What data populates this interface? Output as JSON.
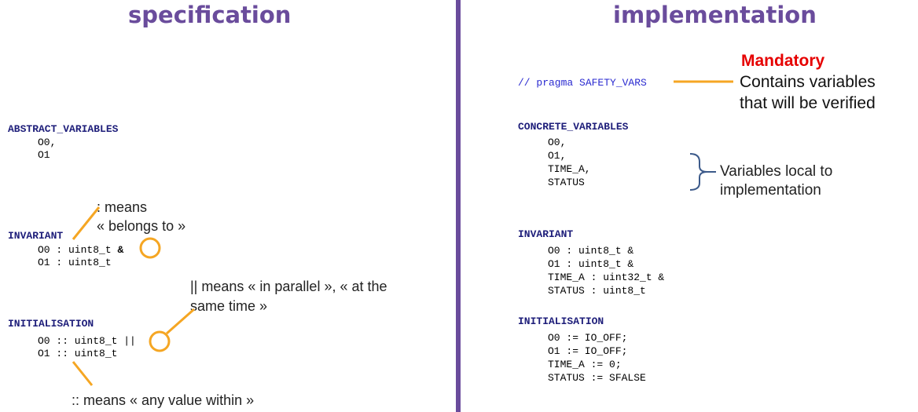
{
  "spec": {
    "title": "specification",
    "abstract_kw": "ABSTRACT_VARIABLES",
    "abstract_lines": [
      "O0,",
      "O1"
    ],
    "invariant_kw": "INVARIANT",
    "invariant_line1": "O0 : uint8_t",
    "invariant_op": "&",
    "invariant_line2": "O1 : uint8_t",
    "init_kw": "INITIALISATION",
    "init_line1": "O0 :: uint8_t",
    "init_op": "||",
    "init_line2": "O1 :: uint8_t",
    "note_belongs_1": ": means",
    "note_belongs_2": "« belongs to »",
    "note_parallel_1": "|| means « in parallel », « at the",
    "note_parallel_2": "same time »",
    "note_within": ":: means « any value within »"
  },
  "impl": {
    "title": "implementation",
    "pragma": "// pragma SAFETY_VARS",
    "mandatory": "Mandatory",
    "mandatory_desc_1": "Contains variables",
    "mandatory_desc_2": "that will be verified",
    "concrete_kw": "CONCRETE_VARIABLES",
    "concrete_lines": [
      "O0,",
      "O1,",
      "TIME_A,",
      "STATUS"
    ],
    "local_note_1": "Variables local to",
    "local_note_2": "implementation",
    "invariant_kw": "INVARIANT",
    "invariant_lines": [
      "O0 : uint8_t &",
      "O1 : uint8_t &",
      "TIME_A : uint32_t &",
      "STATUS : uint8_t"
    ],
    "init_kw": "INITIALISATION",
    "init_lines": [
      "O0 := IO_OFF;",
      "O1 := IO_OFF;",
      "TIME_A := 0;",
      "STATUS := SFALSE"
    ]
  },
  "colors": {
    "title": "#6a4c9c",
    "divider": "#6a4c9c",
    "callout": "#f5a623",
    "mandatory": "#e60000",
    "keyword": "#1e1e7a",
    "brace": "#3c5a8a"
  }
}
